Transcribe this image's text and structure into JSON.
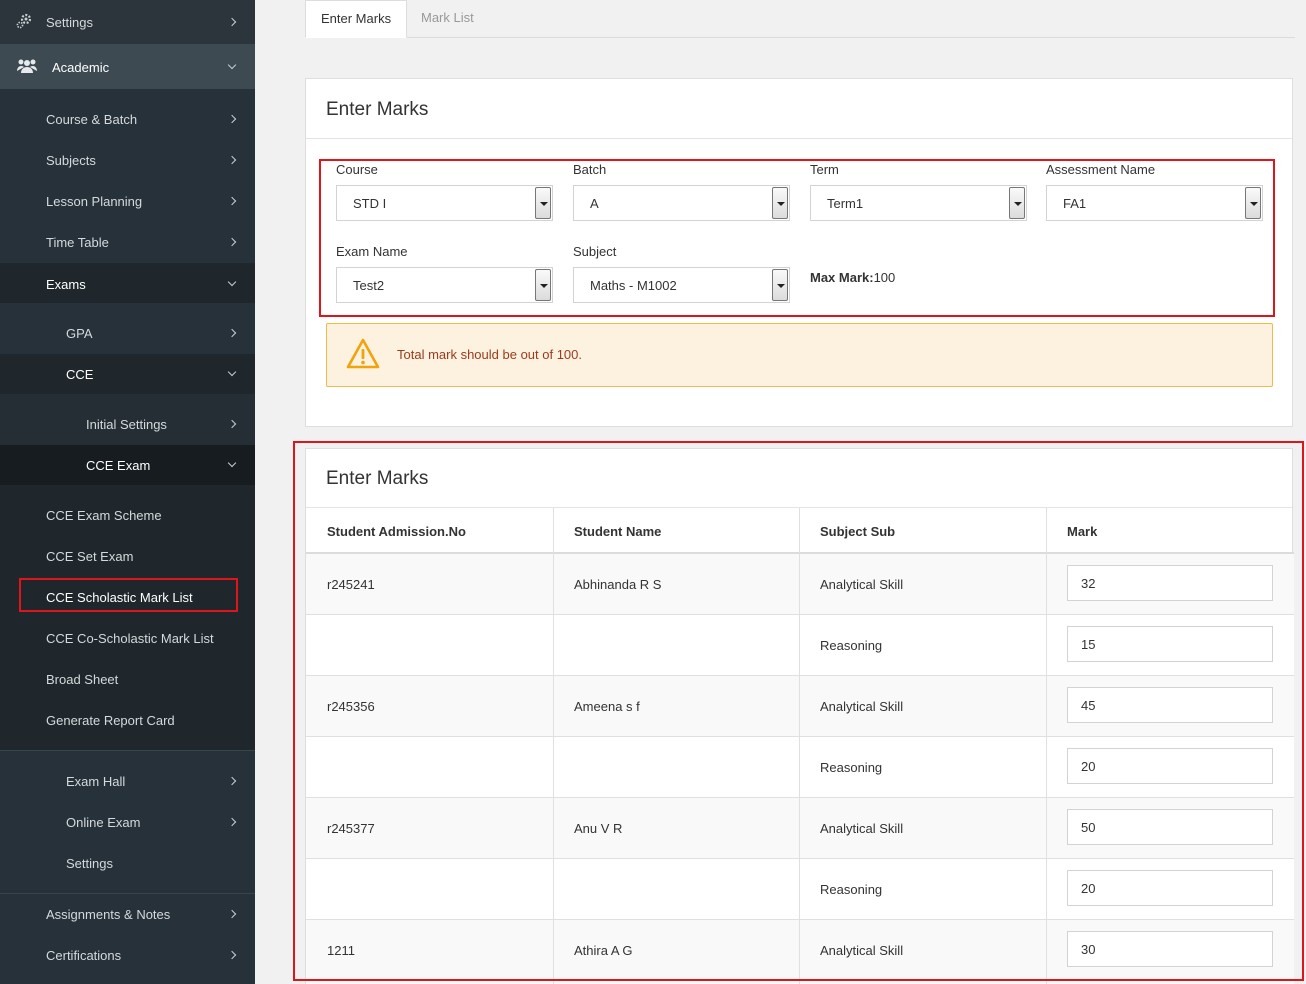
{
  "sidebar": {
    "settings_top": "Settings",
    "academic": "Academic",
    "course_batch": "Course & Batch",
    "subjects": "Subjects",
    "lesson_planning": "Lesson Planning",
    "time_table": "Time Table",
    "exams": "Exams",
    "gpa": "GPA",
    "cce": "CCE",
    "initial_settings": "Initial Settings",
    "cce_exam": "CCE Exam",
    "cce_exam_scheme": "CCE Exam Scheme",
    "cce_set_exam": "CCE Set Exam",
    "cce_scholastic_mark_list": "CCE Scholastic Mark List",
    "cce_co_scholastic_mark_list": "CCE Co-Scholastic Mark List",
    "broad_sheet": "Broad Sheet",
    "generate_report_card": "Generate Report Card",
    "exam_hall": "Exam Hall",
    "online_exam": "Online Exam",
    "exam_settings": "Settings",
    "assignments_notes": "Assignments & Notes",
    "certifications": "Certifications"
  },
  "tabs": {
    "enter_marks": "Enter Marks",
    "mark_list": "Mark List"
  },
  "form": {
    "title": "Enter Marks",
    "course_label": "Course",
    "course_value": "STD I",
    "batch_label": "Batch",
    "batch_value": "A",
    "term_label": "Term",
    "term_value": "Term1",
    "assessment_label": "Assessment Name",
    "assessment_value": "FA1",
    "exam_name_label": "Exam Name",
    "exam_name_value": "Test2",
    "subject_label": "Subject",
    "subject_value": "Maths - M1002",
    "max_mark_label": "Max Mark:",
    "max_mark_value": "100",
    "alert": "Total mark should be out of 100."
  },
  "table": {
    "title": "Enter Marks",
    "headers": [
      "Student Admission.No",
      "Student Name",
      "Subject Sub",
      "Mark"
    ],
    "rows": [
      {
        "adm": "r245241",
        "name": "Abhinanda R S",
        "sub": "Analytical Skill",
        "mark": "32"
      },
      {
        "adm": "",
        "name": "",
        "sub": "Reasoning",
        "mark": "15"
      },
      {
        "adm": "r245356",
        "name": "Ameena s f",
        "sub": "Analytical Skill",
        "mark": "45"
      },
      {
        "adm": "",
        "name": "",
        "sub": "Reasoning",
        "mark": "20"
      },
      {
        "adm": "r245377",
        "name": "Anu V R",
        "sub": "Analytical Skill",
        "mark": "50"
      },
      {
        "adm": "",
        "name": "",
        "sub": "Reasoning",
        "mark": "20"
      },
      {
        "adm": "1211",
        "name": "Athira A G",
        "sub": "Analytical Skill",
        "mark": "30"
      }
    ]
  }
}
